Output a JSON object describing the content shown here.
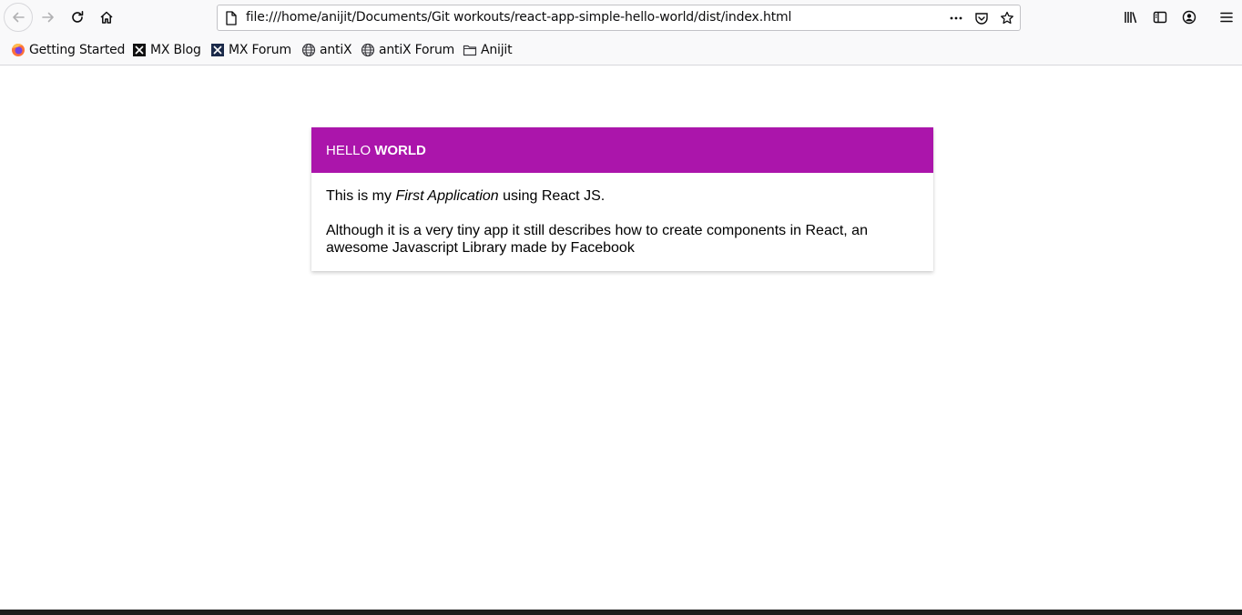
{
  "browser": {
    "url": "file:///home/anijit/Documents/Git workouts/react-app-simple-hello-world/dist/index.html",
    "bookmarks": [
      {
        "label": "Getting Started",
        "icon": "firefox-icon"
      },
      {
        "label": "MX Blog",
        "icon": "mx-logo-icon"
      },
      {
        "label": "MX Forum",
        "icon": "mx-logo-icon"
      },
      {
        "label": "antiX",
        "icon": "globe-icon"
      },
      {
        "label": "antiX Forum",
        "icon": "globe-icon"
      },
      {
        "label": "Anijit",
        "icon": "folder-icon"
      }
    ]
  },
  "card": {
    "header_light": "HELLO",
    "header_bold": "WORLD",
    "header_color": "#ab15ab",
    "line1_before": "This is my ",
    "line1_em": "First Application",
    "line1_after": " using React JS.",
    "paragraph2": "Although it is a very tiny app it still describes how to create components in React, an awesome Javascript Library made by Facebook"
  }
}
